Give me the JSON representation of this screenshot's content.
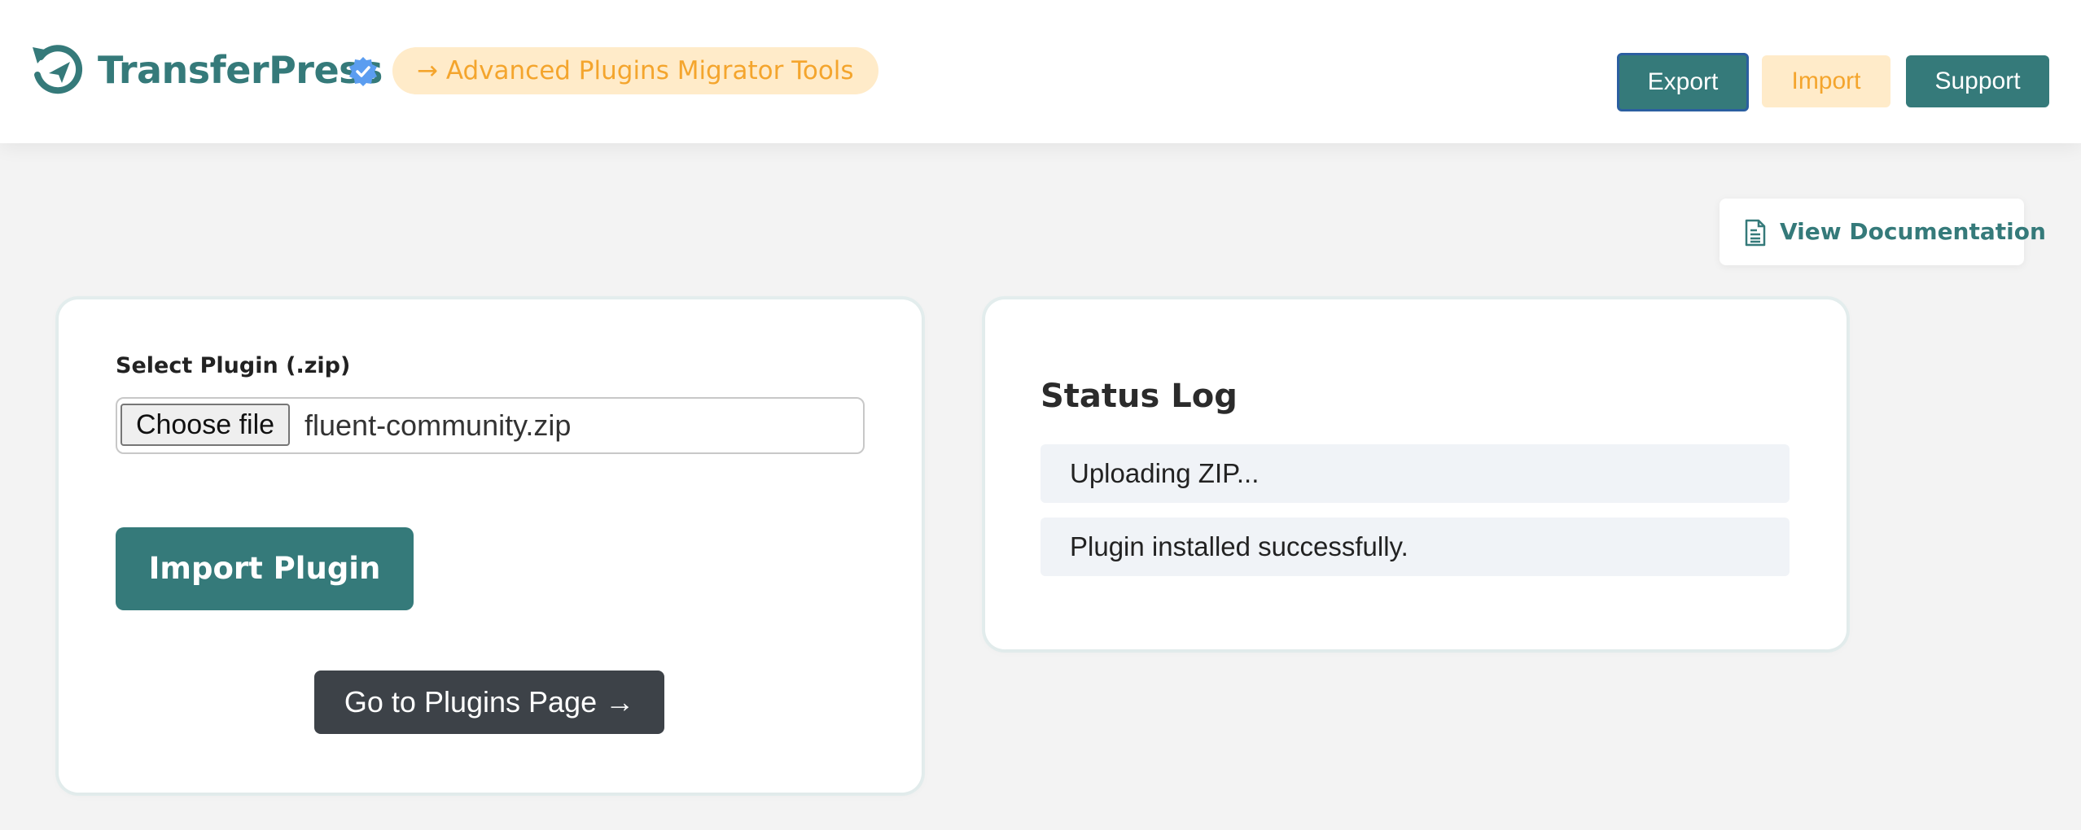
{
  "header": {
    "brand": "TransferPress",
    "tagline": "→ Advanced Plugins Migrator Tools",
    "logo_icon": "refresh-send-icon",
    "verified_icon": "verified-badge-icon",
    "nav": {
      "export_label": "Export",
      "import_label": "Import",
      "support_label": "Support"
    }
  },
  "doc_button": {
    "label": "View Documentation",
    "icon": "document-icon"
  },
  "import_card": {
    "field_label": "Select Plugin (.zip)",
    "choose_file_label": "Choose file",
    "file_name": "fluent-community.zip",
    "import_button_label": "Import Plugin",
    "plugins_page_button_label": "Go to Plugins Page →"
  },
  "status_card": {
    "title": "Status Log",
    "log": [
      "Uploading ZIP...",
      "Plugin installed successfully."
    ]
  },
  "colors": {
    "brand_teal": "#357a7a",
    "accent_amber": "#f4a52d",
    "accent_amber_bg": "#ffebc9",
    "dark_button": "#3d4248",
    "verified_blue": "#5b9df0",
    "page_bg": "#f3f3f3"
  }
}
